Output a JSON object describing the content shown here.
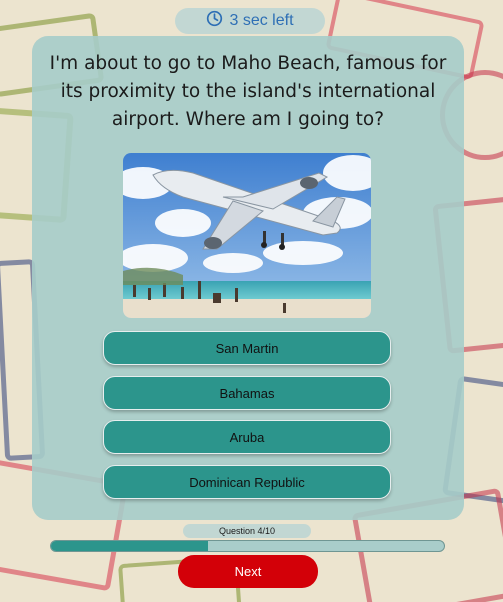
{
  "timer": {
    "label": "3 sec left",
    "icon": "clock-icon"
  },
  "question": {
    "text": "I'm about to go to Maho Beach, famous for its proximity to the island's international airport. Where am I going to?"
  },
  "image": {
    "icon": "airplane-beach-photo"
  },
  "answers": [
    {
      "label": "San Martin"
    },
    {
      "label": "Bahamas"
    },
    {
      "label": "Aruba"
    },
    {
      "label": "Dominican Republic"
    }
  ],
  "progress": {
    "label": "Question 4/10",
    "fraction": 0.4
  },
  "next": {
    "label": "Next"
  },
  "colors": {
    "card": "#a6ccc9",
    "answer": "#2c958c",
    "next": "#d30008",
    "timer_text": "#2e6fb5"
  }
}
